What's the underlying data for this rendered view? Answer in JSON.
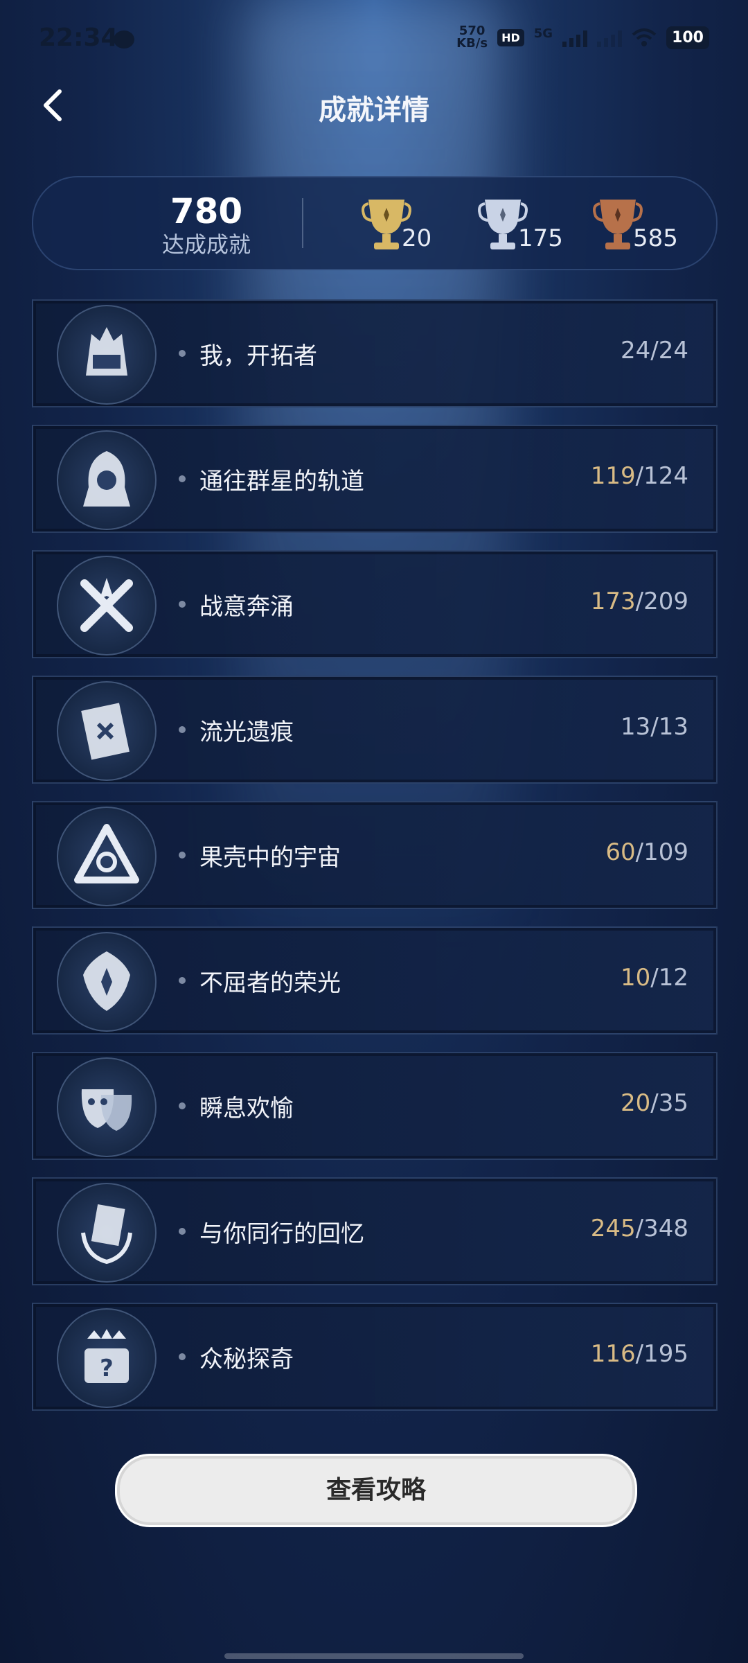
{
  "status_bar": {
    "time": "22:34",
    "net_speed_value": "570",
    "net_speed_unit": "KB/s",
    "hd_label": "HD",
    "signal_label": "5G",
    "battery": "100"
  },
  "header": {
    "title": "成就详情"
  },
  "summary": {
    "total": "780",
    "total_label": "达成成就",
    "gold_count": "20",
    "silver_count": "175",
    "bronze_count": "585",
    "colors": {
      "gold": "#d8b865",
      "silver": "#c9d3e6",
      "bronze": "#b7714a"
    }
  },
  "categories": [
    {
      "name": "我，开拓者",
      "current": "24",
      "total": "/24",
      "icon": "train-crest-icon"
    },
    {
      "name": "通往群星的轨道",
      "current": "119",
      "total": "/124",
      "icon": "hooded-figure-icon"
    },
    {
      "name": "战意奔涌",
      "current": "173",
      "total": "/209",
      "icon": "crossed-swords-icon"
    },
    {
      "name": "流光遗痕",
      "current": "13",
      "total": "/13",
      "icon": "scroll-map-icon"
    },
    {
      "name": "果壳中的宇宙",
      "current": "60",
      "total": "/109",
      "icon": "triangle-knot-icon"
    },
    {
      "name": "不屈者的荣光",
      "current": "10",
      "total": "/12",
      "icon": "ornate-shield-icon"
    },
    {
      "name": "瞬息欢愉",
      "current": "20",
      "total": "/35",
      "icon": "masks-icon"
    },
    {
      "name": "与你同行的回忆",
      "current": "245",
      "total": "/348",
      "icon": "laurel-letter-icon"
    },
    {
      "name": "众秘探奇",
      "current": "116",
      "total": "/195",
      "icon": "treasure-chest-icon"
    }
  ],
  "guide_button": "查看攻略",
  "accent_partial": "#d9bb85"
}
